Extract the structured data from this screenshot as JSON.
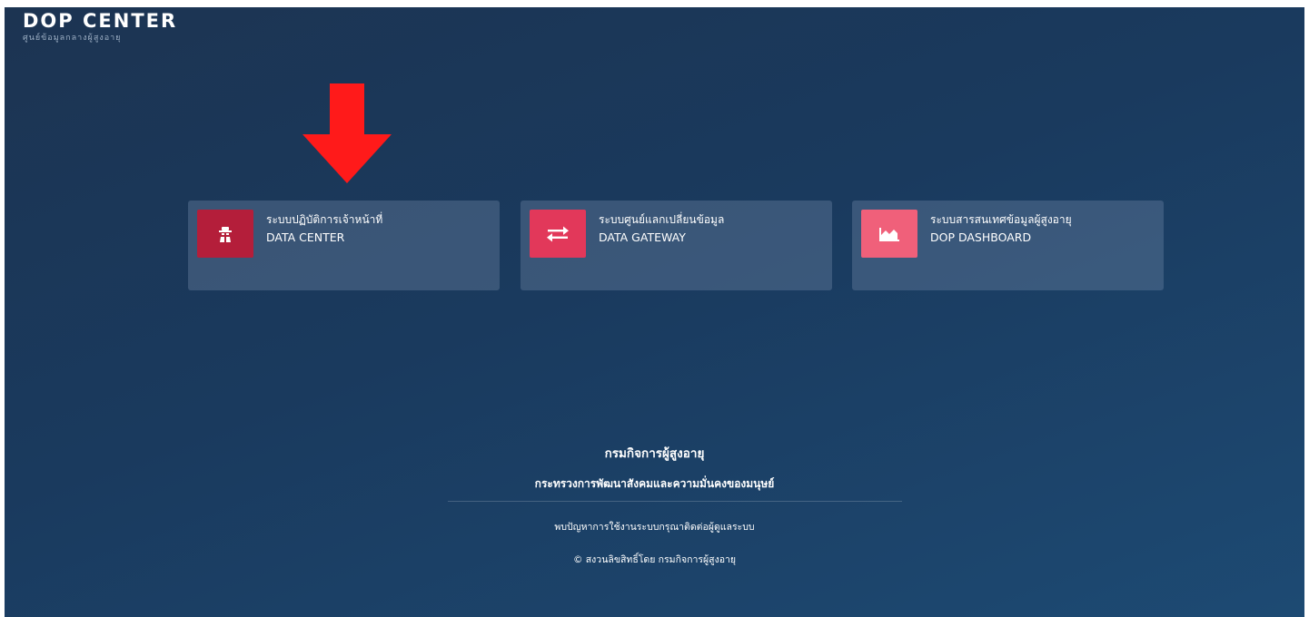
{
  "brand": {
    "title": "DOP CENTER",
    "subtitle": "ศูนย์ข้อมูลกลางผู้สูงอายุ"
  },
  "cards": [
    {
      "title_th": "ระบบปฏิบัติการเจ้าหน้าที่",
      "title_en": "DATA CENTER",
      "icon": "spy-icon",
      "color": "#b41e3a"
    },
    {
      "title_th": "ระบบศูนย์แลกเปลี่ยนข้อมูล",
      "title_en": "DATA GATEWAY",
      "icon": "swap-arrows-icon",
      "color": "#e2385a"
    },
    {
      "title_th": "ระบบสารสนเทศข้อมูลผู้สูงอายุ",
      "title_en": "DOP DASHBOARD",
      "icon": "area-chart-icon",
      "color": "#f0607a"
    }
  ],
  "footer": {
    "organization": "กรมกิจการผู้สูงอายุ",
    "ministry": "กระทรวงการพัฒนาสังคมและความมั่นคงของมนุษย์",
    "contact": "พบปัญหาการใช้งานระบบกรุณาติดต่อผู้ดูแลระบบ",
    "copyright": "© สงวนลิขสิทธิ์โดย กรมกิจการผู้สูงอายุ"
  },
  "annotation": {
    "arrow_color": "#ff1a1a"
  }
}
